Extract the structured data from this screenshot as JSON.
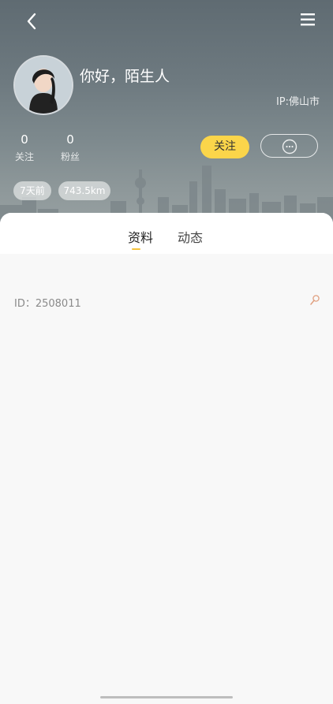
{
  "header": {
    "greeting": "你好，陌生人",
    "ip_location": "IP:佛山市",
    "stats": [
      {
        "value": "0",
        "label": "关注"
      },
      {
        "value": "0",
        "label": "粉丝"
      }
    ],
    "follow_label": "关注",
    "chips": [
      "7天前",
      "743.5km"
    ]
  },
  "tabs": [
    {
      "label": "资料",
      "active": true
    },
    {
      "label": "动态",
      "active": false
    }
  ],
  "profile": {
    "id_text": "ID：2508011"
  },
  "colors": {
    "accent": "#fbd54a",
    "tab_indicator": "#f5c33b"
  },
  "icons": {
    "back": "chevron-left-icon",
    "menu": "hamburger-menu-icon",
    "message": "chat-bubble-icon",
    "copy": "magnifier-copy-icon"
  }
}
